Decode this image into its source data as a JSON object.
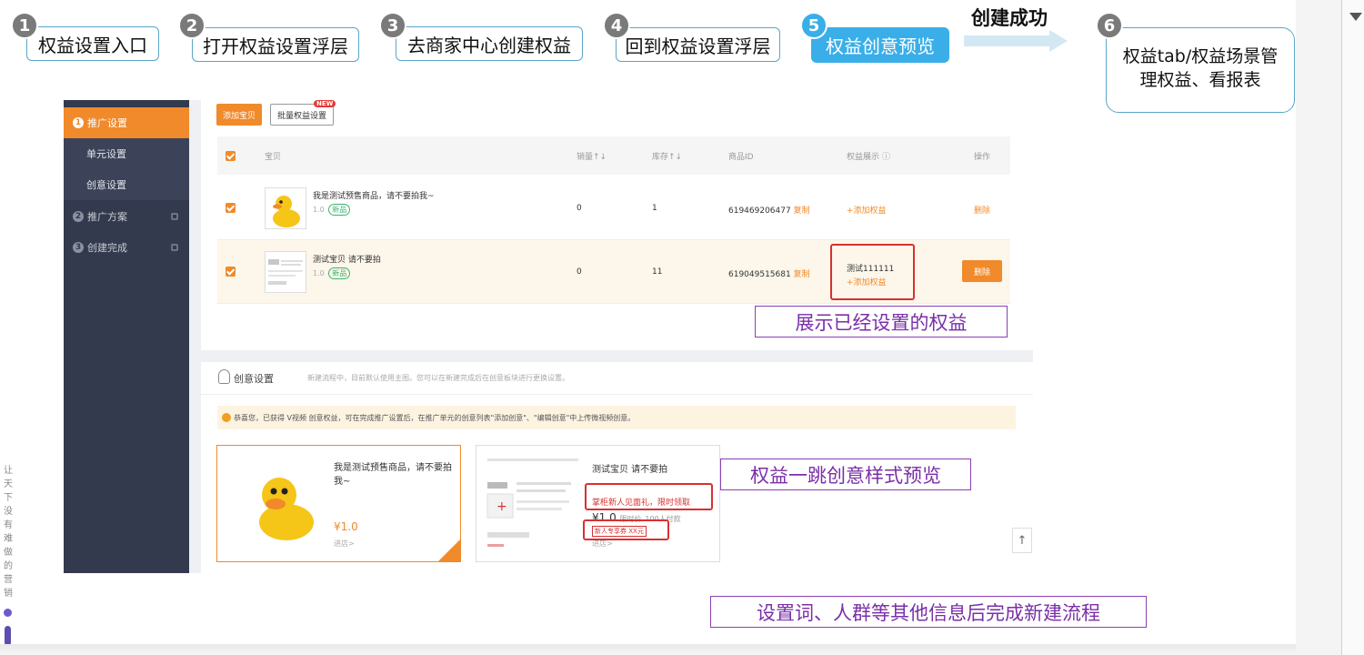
{
  "steps": [
    {
      "num": "1",
      "label": "权益设置入口"
    },
    {
      "num": "2",
      "label": "打开权益设置浮层"
    },
    {
      "num": "3",
      "label": "去商家中心创建权益"
    },
    {
      "num": "4",
      "label": "回到权益设置浮层"
    },
    {
      "num": "5",
      "label": "权益创意预览"
    },
    {
      "num": "6",
      "label_line1": "权益tab/权益场景管",
      "label_line2": "理权益、看报表"
    }
  ],
  "success_label": "创建成功",
  "sidebar": {
    "items": [
      {
        "num": "1",
        "label": "推广设置"
      },
      {
        "label": "单元设置"
      },
      {
        "label": "创意设置"
      },
      {
        "num": "2",
        "label": "推广方案"
      },
      {
        "num": "3",
        "label": "创建完成"
      }
    ]
  },
  "toolbar": {
    "add_item": "添加宝贝",
    "batch_rights": "批量权益设置",
    "new_badge": "NEW"
  },
  "table": {
    "headers": [
      "宝贝",
      "销量↑↓",
      "库存↑↓",
      "商品ID",
      "权益展示 ⓘ",
      "操作"
    ],
    "rows": [
      {
        "title": "我是测试预售商品，请不要拍我~",
        "price": "1.0",
        "tag": "新品",
        "sales": "0",
        "stock": "1",
        "id": "619469206477",
        "copy": "复制",
        "rights": "",
        "add_rights": "+添加权益",
        "action": "删除"
      },
      {
        "title": "测试宝贝 请不要拍",
        "price": "1.0",
        "tag": "新品",
        "sales": "0",
        "stock": "11",
        "id": "619049515681",
        "copy": "复制",
        "rights": "测试111111",
        "add_rights": "+添加权益",
        "action": "删除"
      }
    ]
  },
  "annotations": {
    "show_rights": "展示已经设置的权益",
    "preview": "权益一跳创意样式预览",
    "finish": "设置词、人群等其他信息后完成新建流程"
  },
  "creative": {
    "title": "创意设置",
    "tip": "新建流程中，目前默认使用主图。您可以在新建完成后在创意板块进行更换设置。",
    "notice": "恭喜您，已获得 V视频 创意权益，可在完成推广设置后，在推广单元的创意列表\"添加创意\"、\"编辑创意\"中上传微视频创意。",
    "card1": {
      "title": "我是测试预售商品，请不要拍我~",
      "price": "¥1.0",
      "link": "进店>"
    },
    "card2": {
      "title": "测试宝贝 请不要拍",
      "rights1": "掌柜新人见面礼，限时领取",
      "price": "¥1.0",
      "price_note": "限时价",
      "pay_note": "100人付款",
      "rights2": "新人专享券 XX元",
      "link": "进店>"
    }
  },
  "left_vertical_text": "让天下没有难做的营销",
  "scroll_top_icon": "↑"
}
